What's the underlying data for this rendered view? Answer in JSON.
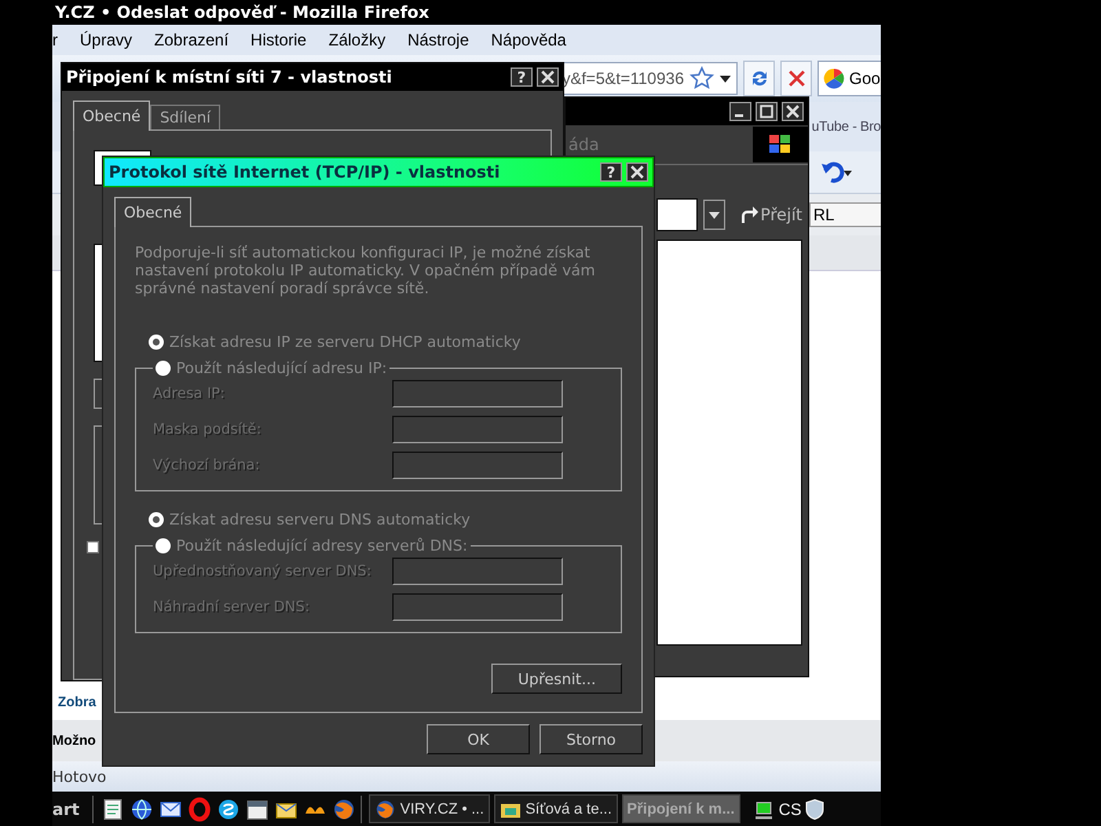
{
  "firefox": {
    "title": "Y.CZ • Odeslat odpověď - Mozilla Firefox",
    "menu": [
      "r",
      "Úpravy",
      "Zobrazení",
      "Historie",
      "Záložky",
      "Nástroje",
      "Nápověda"
    ],
    "address": "y&f=5&t=110936",
    "search": "Goo",
    "tab_title": "uTube - Bro",
    "url_button": "RL",
    "page_link": "Zobra",
    "page_heading": "Možno",
    "status": "Hotovo"
  },
  "connection_dialog": {
    "title": "Připojení k místní síti 7 - vlastnosti",
    "help": "?",
    "tabs": [
      {
        "label": "Obecné",
        "selected": true
      },
      {
        "label": "Sdílení",
        "selected": false
      }
    ],
    "checkbox": {
      "checked": false
    }
  },
  "browser_window": {
    "menu_fragment": "áda",
    "go_button": "Přejít"
  },
  "tcpip_dialog": {
    "title": "Protokol sítě Internet (TCP/IP) - vlastnosti",
    "help": "?",
    "tabs": [
      {
        "label": "Obecné",
        "selected": true
      }
    ],
    "description": "Podporuje-li síť automatickou konfiguraci IP, je možné získat nastavení protokolu IP automaticky. V opačném případě vám správné nastavení poradí správce sítě.",
    "ip_options": [
      {
        "label": "Získat adresu IP ze serveru DHCP automaticky",
        "selected": true
      },
      {
        "label": "Použít následující adresu IP:",
        "selected": false
      }
    ],
    "ip_fields": [
      {
        "label": "Adresa IP:"
      },
      {
        "label": "Maska podsítě:"
      },
      {
        "label": "Výchozí brána:"
      }
    ],
    "dns_options": [
      {
        "label": "Získat adresu serveru DNS automaticky",
        "selected": true
      },
      {
        "label": "Použít následující adresy serverů DNS:",
        "selected": false
      }
    ],
    "dns_fields": [
      {
        "label": "Upřednostňovaný server DNS:"
      },
      {
        "label": "Náhradní server DNS:"
      }
    ],
    "advanced_button": "Upřesnit...",
    "buttons": [
      "OK",
      "Storno"
    ]
  },
  "taskbar": {
    "start": "art",
    "tasks": [
      {
        "label": "VIRY.CZ • ...",
        "selected": false
      },
      {
        "label": "Síťová a te...",
        "selected": false
      },
      {
        "label": "Připojení k m...",
        "selected": true
      }
    ],
    "language": "CS"
  }
}
